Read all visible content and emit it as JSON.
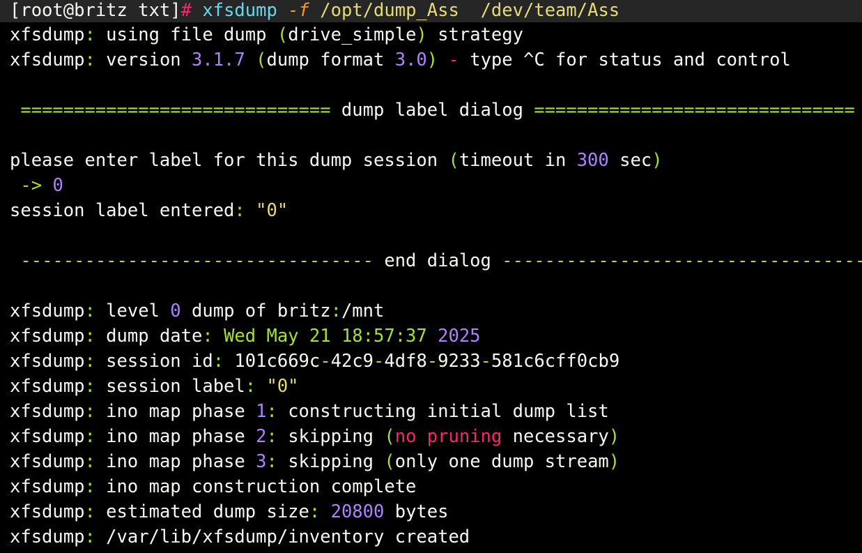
{
  "terminal": {
    "prompt": {
      "user_host_dir": "[root@britz txt]",
      "symbol": "#",
      "command": "xfsdump",
      "flag": "-f",
      "arg1": "/opt/dump_Ass",
      "arg2": "/dev/team/Ass"
    },
    "lines": {
      "l1_prog": "xfsdump",
      "l1_a": " using file dump ",
      "l1_b": "drive_simple",
      "l1_c": " strategy",
      "l2_prog": "xfsdump",
      "l2_a": " version ",
      "l2_ver": "3.1.7",
      "l2_b": "dump format ",
      "l2_fmt": "3.0",
      "l2_c": " type ^C for status and control",
      "dialog_header_left": "=============================",
      "dialog_header_title": " dump label dialog ",
      "dialog_header_right": "==============================",
      "ask_a": "please enter label for this dump session ",
      "ask_b": "timeout in ",
      "ask_timeout": "300",
      "ask_c": " sec",
      "arrow": "->",
      "answer": "0",
      "entered_a": "session label entered",
      "entered_val": " \"0\"",
      "dialog_footer_left": "---------------------------------",
      "dialog_footer_title": " end dialog ",
      "dialog_footer_right": "------------------------------------",
      "level_a": " level ",
      "level_num": "0",
      "level_b": " dump of britz",
      "level_c": "/mnt",
      "date_a": " dump date",
      "date_b": " Wed May 21 18:57:37 ",
      "date_year": "2025",
      "sid_a": " session id",
      "sid_p1": " 101c669c",
      "sid_p2": "42c9",
      "sid_p3": "4df8",
      "sid_p4": "9233",
      "sid_p5": "581c6cff0cb9",
      "slabel_a": " session label",
      "slabel_b": " \"0\"",
      "ph1_a": " ino map phase ",
      "ph1_num": "1",
      "ph1_b": " constructing initial dump list",
      "ph2_a": " ino map phase ",
      "ph2_num": "2",
      "ph2_b": " skipping ",
      "ph2_red": "no pruning",
      "ph2_c": " necessary",
      "ph3_a": " ino map phase ",
      "ph3_num": "3",
      "ph3_b": " skipping ",
      "ph3_c": "only one dump stream",
      "complete_a": " ino map construction complete",
      "est_a": " estimated dump size",
      "est_num": "20800",
      "est_b": " bytes",
      "inv_a": " /var/lib/xfsdump/inventory created"
    }
  }
}
